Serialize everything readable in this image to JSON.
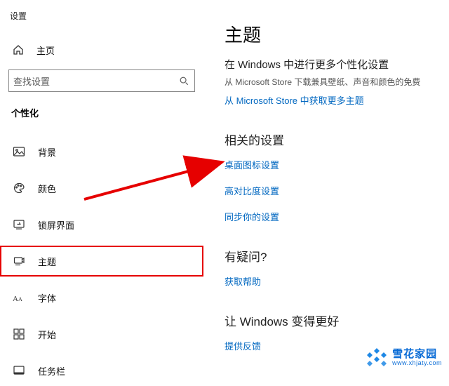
{
  "app_title": "设置",
  "home_label": "主页",
  "search_placeholder": "查找设置",
  "category_label": "个性化",
  "nav": [
    {
      "key": "background",
      "label": "背景"
    },
    {
      "key": "colors",
      "label": "颜色"
    },
    {
      "key": "lockscreen",
      "label": "锁屏界面"
    },
    {
      "key": "themes",
      "label": "主题",
      "selected": true
    },
    {
      "key": "fonts",
      "label": "字体"
    },
    {
      "key": "start",
      "label": "开始"
    },
    {
      "key": "taskbar",
      "label": "任务栏"
    }
  ],
  "main": {
    "heading": "主题",
    "subtitle": "在 Windows 中进行更多个性化设置",
    "helper": "从 Microsoft Store 下载兼具壁纸、声音和颜色的免费",
    "store_link": "从 Microsoft Store 中获取更多主题",
    "related": {
      "title": "相关的设置",
      "links": {
        "desktop_icons": "桌面图标设置",
        "high_contrast": "高对比度设置",
        "sync": "同步你的设置"
      }
    },
    "help": {
      "title": "有疑问?",
      "link": "获取帮助"
    },
    "feedback": {
      "title": "让 Windows 变得更好",
      "link": "提供反馈"
    }
  },
  "watermark": {
    "name": "雪花家园",
    "url": "www.xhjaty.com"
  },
  "annotation": {
    "arrow_color": "#e60000",
    "highlight_color": "#e60000"
  }
}
